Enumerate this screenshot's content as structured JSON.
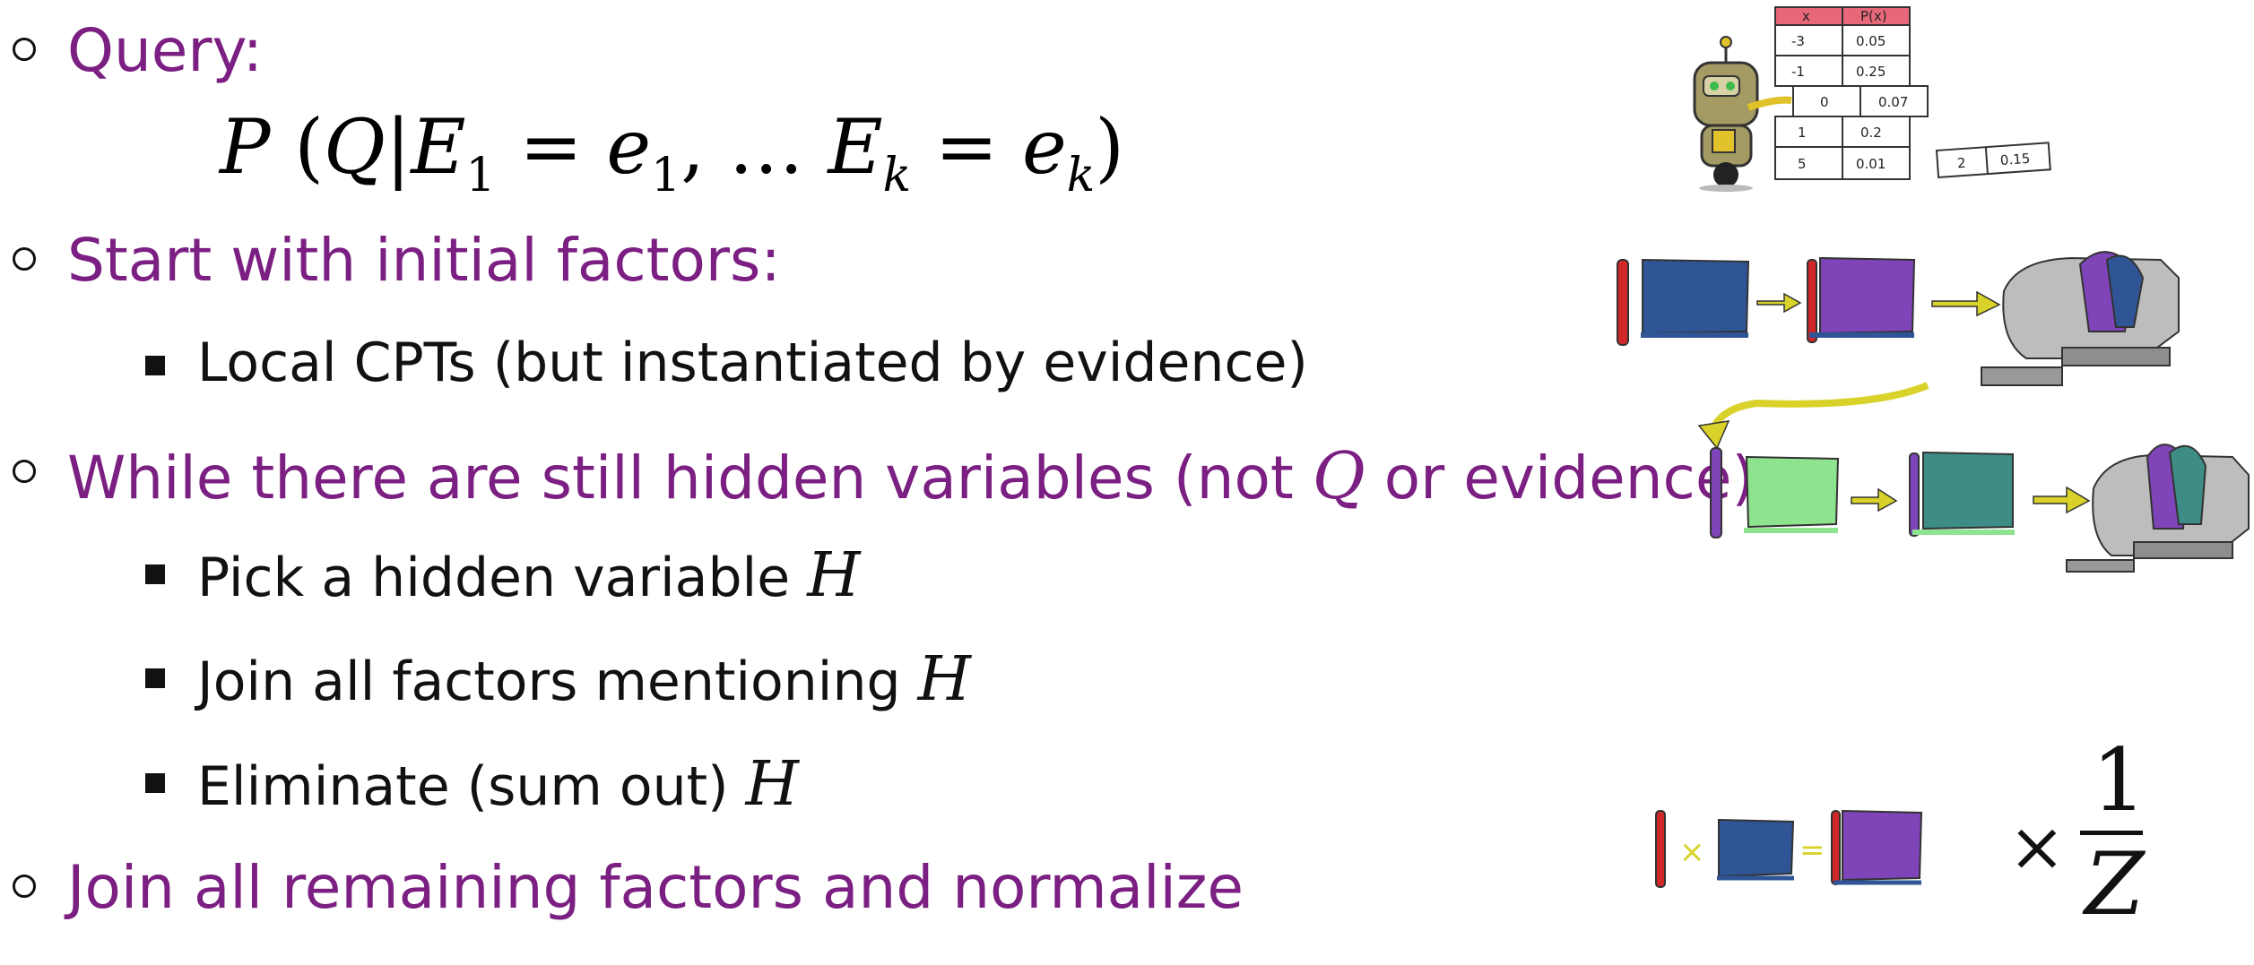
{
  "items": [
    {
      "label": "Query:"
    },
    {
      "label": "Start with initial factors:"
    },
    {
      "label": "Local CPTs (but instantiated by evidence)"
    },
    {
      "label_pre": "While there are still hidden variables (not ",
      "label_var": "Q",
      "label_post": " or evidence):"
    },
    {
      "label_pre": "Pick a hidden variable ",
      "label_var": "H"
    },
    {
      "label_pre": "Join all factors mentioning ",
      "label_var": "H"
    },
    {
      "label_pre": "Eliminate (sum out) ",
      "label_var": "H"
    },
    {
      "label": "Join all remaining factors and normalize"
    }
  ],
  "formula": {
    "P": "P",
    "open": "(",
    "Q": "Q",
    "bar": "|",
    "E": "E",
    "one": "1",
    "eq1": " = ",
    "e": "e",
    "sep": ", … ",
    "k": "k",
    "close": ")"
  },
  "cpt_table": {
    "headers": [
      "x",
      "P(x)"
    ],
    "rows": [
      [
        "-3",
        "0.05"
      ],
      [
        "-1",
        "0.25"
      ],
      [
        "0",
        "0.07"
      ],
      [
        "1",
        "0.2"
      ],
      [
        "5",
        "0.01"
      ]
    ],
    "extra": [
      "2",
      "0.15"
    ]
  },
  "normalize": {
    "times": "×",
    "numerator": "1",
    "denominator": "Z"
  },
  "colors": {
    "purple": "#7b1f82",
    "blue": "#2f5597",
    "violet": "#7e44b8",
    "green": "#8ee38e",
    "teal": "#3d8d86",
    "red": "#d02828",
    "yellow": "#d8d22a"
  }
}
